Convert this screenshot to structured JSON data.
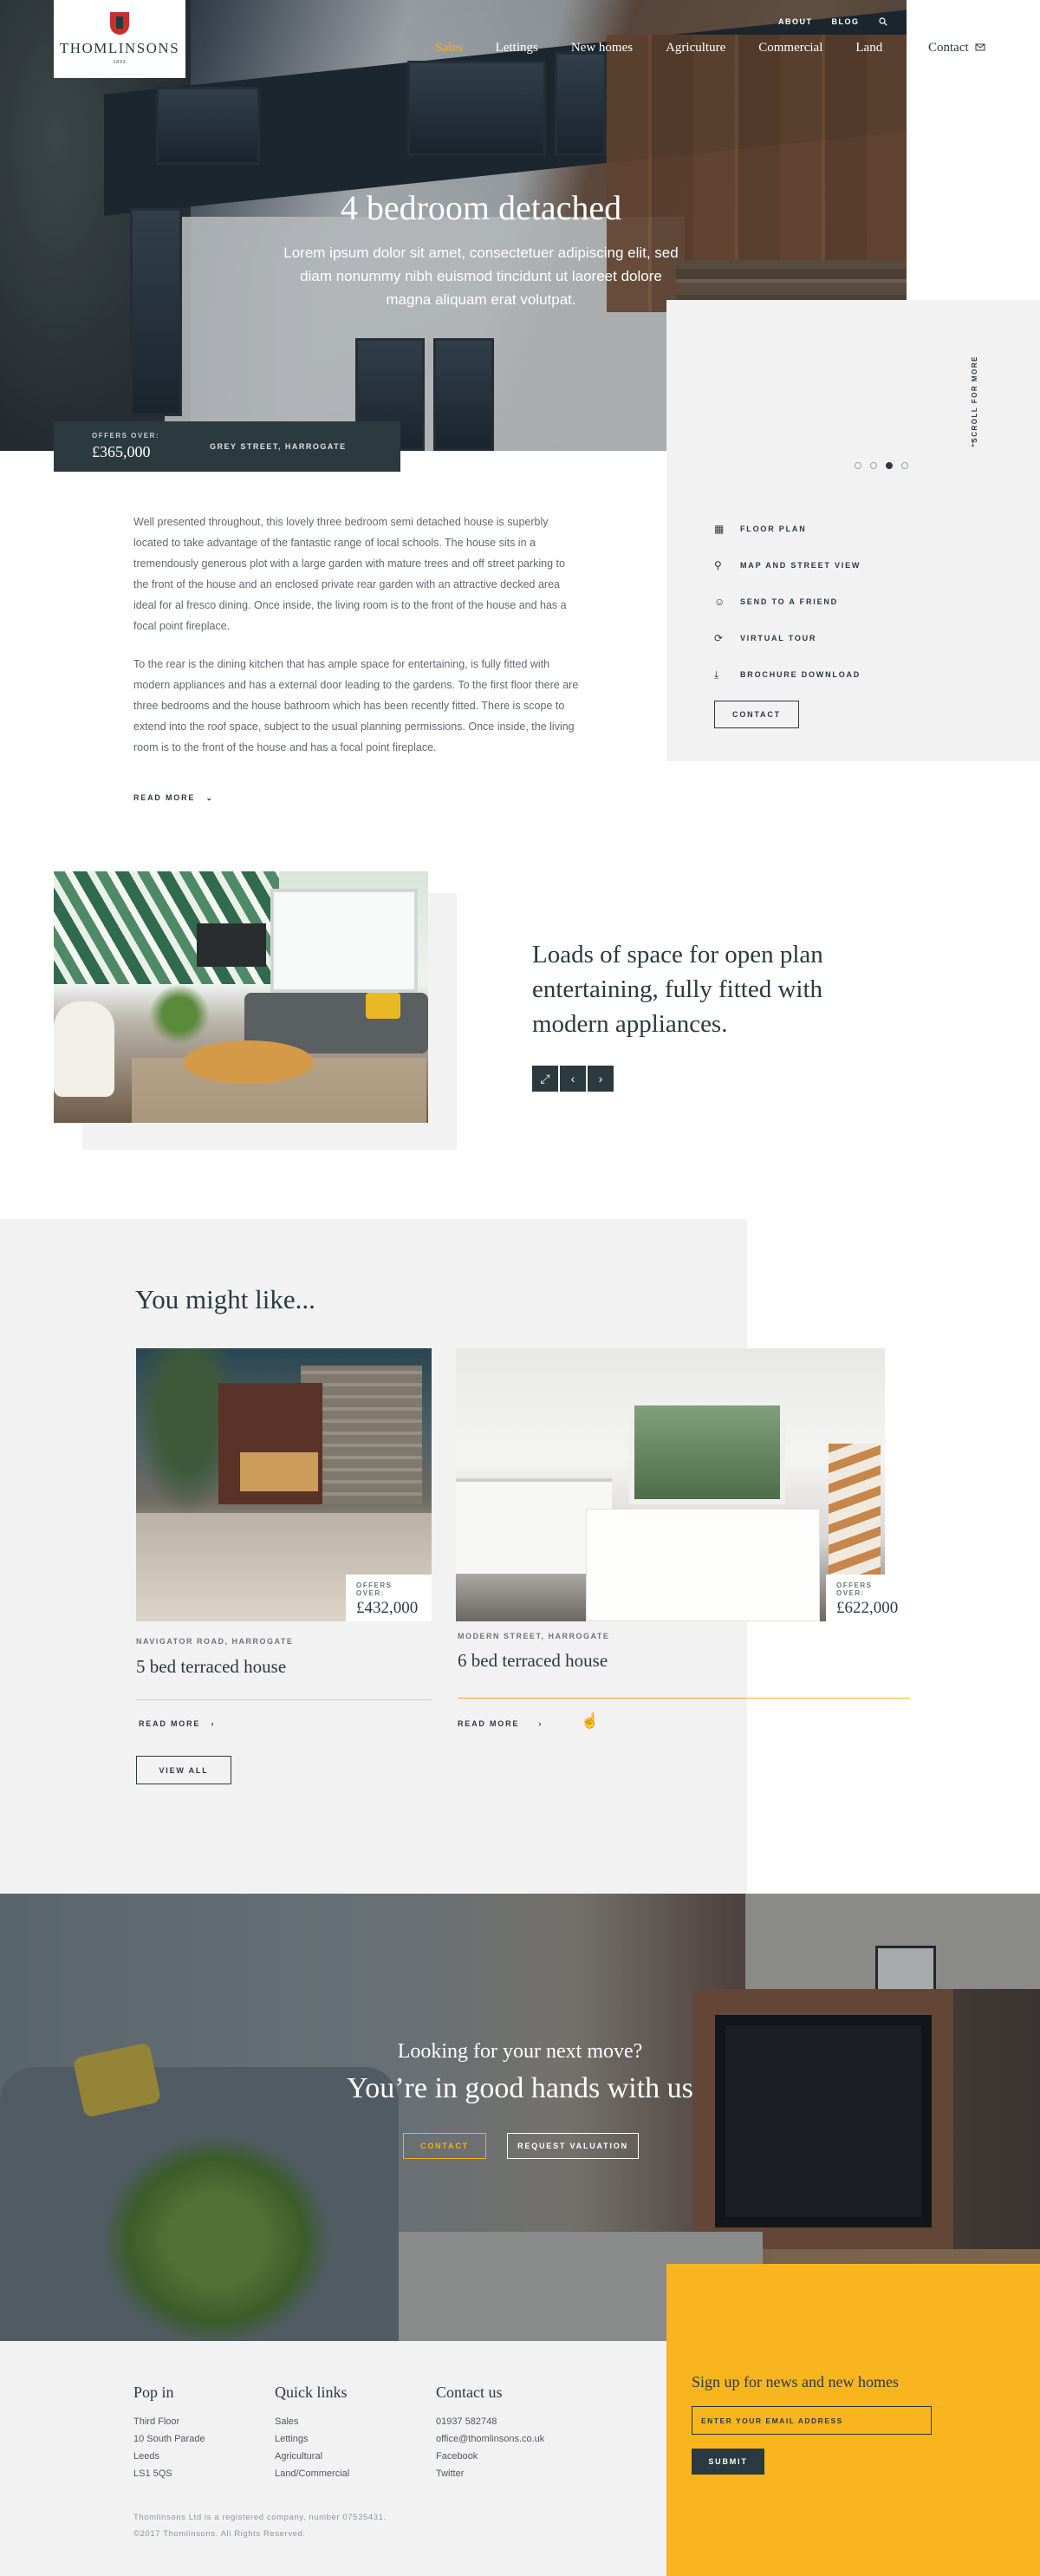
{
  "brand": {
    "name": "THOMLINSONS",
    "tagline": "1893"
  },
  "header": {
    "top_links": [
      "ABOUT",
      "BLOG"
    ],
    "nav": [
      "Sales",
      "Lettings",
      "New homes",
      "Agriculture",
      "Commercial",
      "Land"
    ],
    "active_nav": "Sales",
    "contact_label": "Contact"
  },
  "hero": {
    "title": "4 bedroom detached",
    "subtitle": "Lorem ipsum dolor sit amet, consectetuer adipiscing elit, sed diam nonummy nibh euismod tincidunt ut laoreet dolore magna aliquam erat volutpat.",
    "price_label": "OFFERS OVER:",
    "price": "£365,000",
    "street": "GREY STREET, HARROGATE",
    "scroll_label": "SCROLL FOR MORE",
    "slide_count": 4,
    "active_slide": 3
  },
  "property": {
    "paragraphs": [
      "Well presented throughout, this lovely three bedroom semi detached house is superbly located to take advantage of the fantastic range of local schools. The house sits in a tremendously generous plot with a large garden with mature trees and off street parking to the front of the house and an enclosed private rear garden with an attractive decked area ideal for al fresco dining. Once inside, the living room is to the front of the house and has a focal point fireplace.",
      "To the rear is the dining kitchen that has ample space for entertaining, is fully fitted with modern appliances and has a external door leading to the gardens. To the first floor there are three bedrooms and the house bathroom which has been recently fitted. There is scope to extend into the roof space, subject to the usual planning permissions. Once inside, the living room is to the front of the house and has a focal point fireplace."
    ],
    "read_more": "READ MORE",
    "actions": [
      {
        "icon": "floor-plan-icon",
        "label": "FLOOR PLAN"
      },
      {
        "icon": "map-pin-icon",
        "label": "MAP AND STREET VIEW"
      },
      {
        "icon": "smiley-icon",
        "label": "SEND TO A FRIEND"
      },
      {
        "icon": "rotate-icon",
        "label": "VIRTUAL TOUR"
      },
      {
        "icon": "download-icon",
        "label": "BROCHURE DOWNLOAD"
      }
    ],
    "contact_button": "CONTACT"
  },
  "feature": {
    "text": "Loads of space for open plan entertaining, fully fitted with modern appliances."
  },
  "might_like": {
    "title": "You might like...",
    "cards": [
      {
        "street": "NAVIGATOR ROAD, HARROGATE",
        "title": "5 bed terraced house",
        "price_label": "OFFERS OVER:",
        "price": "£432,000",
        "read_more": "READ MORE"
      },
      {
        "street": "MODERN STREET, HARROGATE",
        "title": "6 bed terraced house",
        "price_label": "OFFERS OVER:",
        "price": "£622,000",
        "read_more": "READ MORE"
      }
    ],
    "view_all": "VIEW ALL"
  },
  "cta": {
    "subtitle": "Looking for your next move?",
    "title": "You’re in good hands with us",
    "contact": "CONTACT",
    "valuation": "REQUEST VALUATION"
  },
  "footer": {
    "pop_in": {
      "title": "Pop in",
      "lines": [
        "Third Floor",
        "10 South Parade",
        "Leeds",
        "LS1 5QS"
      ]
    },
    "quick_links": {
      "title": "Quick links",
      "lines": [
        "Sales",
        "Lettings",
        "Agricultural",
        "Land/Commercial"
      ]
    },
    "contact_us": {
      "title": "Contact us",
      "lines": [
        "01937 582748",
        "office@thomlinsons.co.uk",
        "Facebook",
        "Twitter"
      ]
    },
    "legal": "Thomlinsons Ltd is a registered company, number 07535431.",
    "copyright": "©2017 Thomlinsons. All Rights Reserved.",
    "signup": {
      "title": "Sign up for news and new homes",
      "placeholder": "ENTER YOUR EMAIL ADDRESS",
      "submit": "SUBMIT"
    }
  },
  "colors": {
    "primary": "#2a3a3f",
    "accent": "#f4b01e",
    "panel": "#f2f2f2",
    "signup": "#f9b51e"
  }
}
